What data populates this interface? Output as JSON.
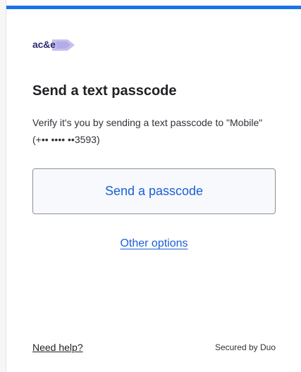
{
  "colors": {
    "accent": "#1a73e8",
    "link": "#1a5fd8",
    "logo_arrow": "#b9b3e6"
  },
  "logo": {
    "text": "ac&e"
  },
  "main": {
    "title": "Send a text passcode",
    "description": "Verify it's you by sending a text passcode to \"Mobile\" (+•• •••• ••3593)",
    "send_button_label": "Send a passcode",
    "other_options_label": "Other options"
  },
  "footer": {
    "help_label": "Need help?",
    "secured_label": "Secured by Duo"
  }
}
